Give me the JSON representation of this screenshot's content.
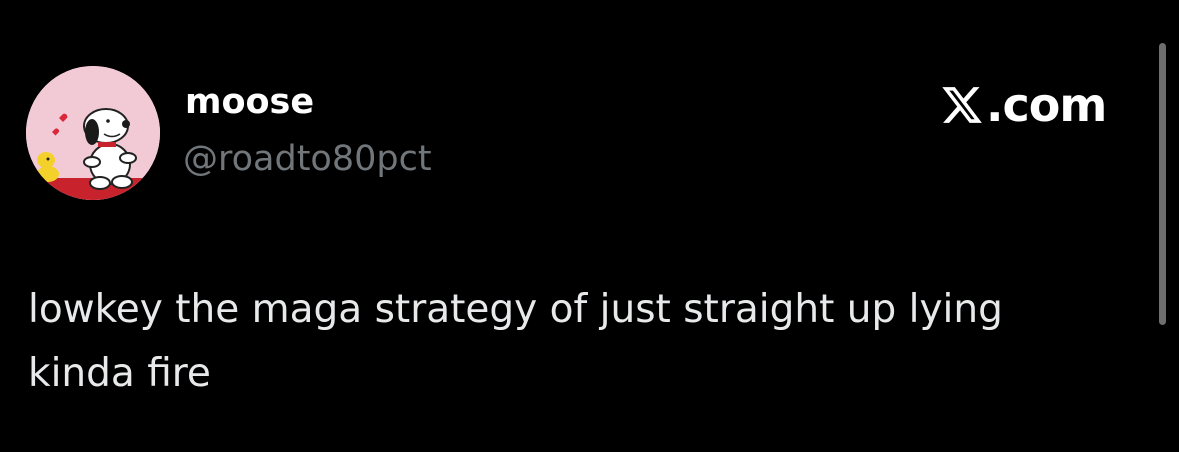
{
  "author": {
    "display_name": "moose",
    "handle": "@roadto80pct",
    "avatar_icon": "snoopy-avatar-icon"
  },
  "brand": {
    "logo_icon": "x-logo-icon",
    "text": ".com"
  },
  "tweet": {
    "lines": [
      "lowkey the maga strategy of just straight up lying",
      "kinda fire"
    ]
  },
  "colors": {
    "background": "#000000",
    "primary_text": "#ffffff",
    "secondary_text": "#71767b",
    "avatar_bg": "#f2cad6"
  }
}
